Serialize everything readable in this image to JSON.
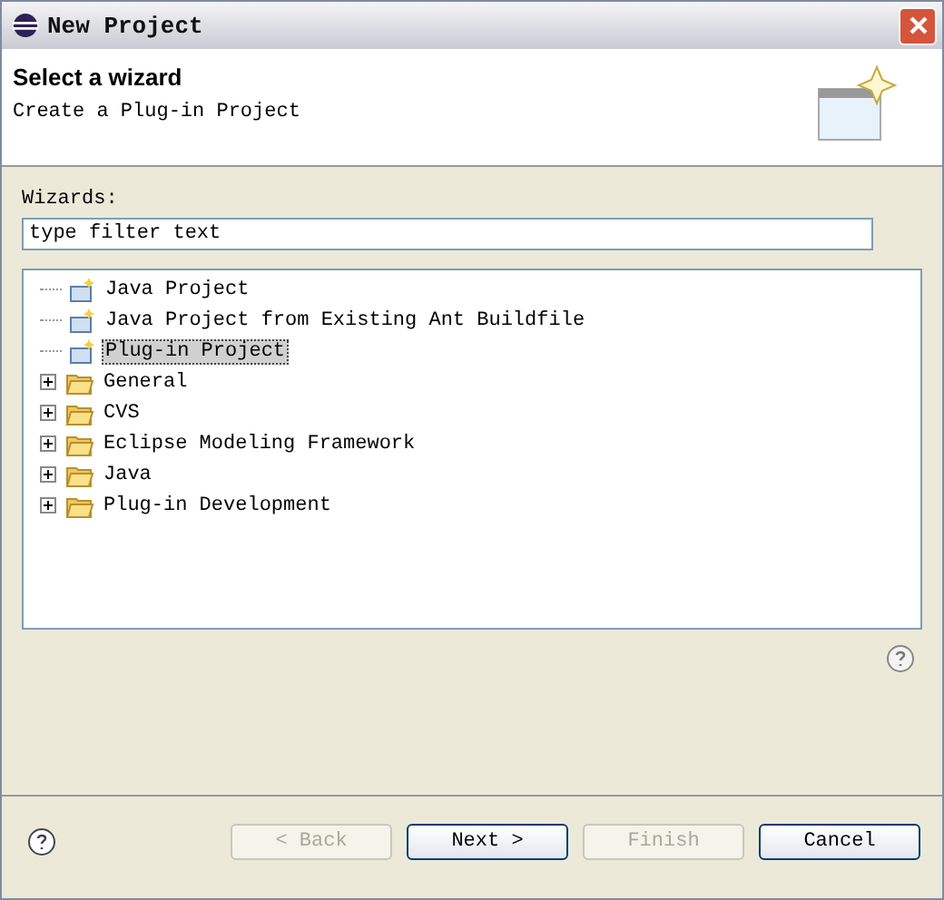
{
  "window": {
    "title": "New Project"
  },
  "header": {
    "title": "Select a wizard",
    "description": "Create a Plug-in Project"
  },
  "wizards": {
    "label": "Wizards:",
    "filter": {
      "placeholder": "type filter text"
    },
    "items": [
      {
        "kind": "leaf",
        "label": "Java Project",
        "selected": false
      },
      {
        "kind": "leaf",
        "label": "Java Project from Existing Ant Buildfile",
        "selected": false
      },
      {
        "kind": "leaf",
        "label": "Plug-in Project",
        "selected": true
      },
      {
        "kind": "folder",
        "label": "General",
        "expanded": false,
        "selected": false
      },
      {
        "kind": "folder",
        "label": "CVS",
        "expanded": false,
        "selected": false
      },
      {
        "kind": "folder",
        "label": "Eclipse Modeling Framework",
        "expanded": false,
        "selected": false
      },
      {
        "kind": "folder",
        "label": "Java",
        "expanded": false,
        "selected": false
      },
      {
        "kind": "folder",
        "label": "Plug-in Development",
        "expanded": false,
        "selected": false
      }
    ]
  },
  "buttons": [
    {
      "label": "< Back",
      "disabled": true
    },
    {
      "label": "Next >",
      "disabled": false
    },
    {
      "label": "Finish",
      "disabled": true
    },
    {
      "label": "Cancel",
      "disabled": false
    }
  ]
}
